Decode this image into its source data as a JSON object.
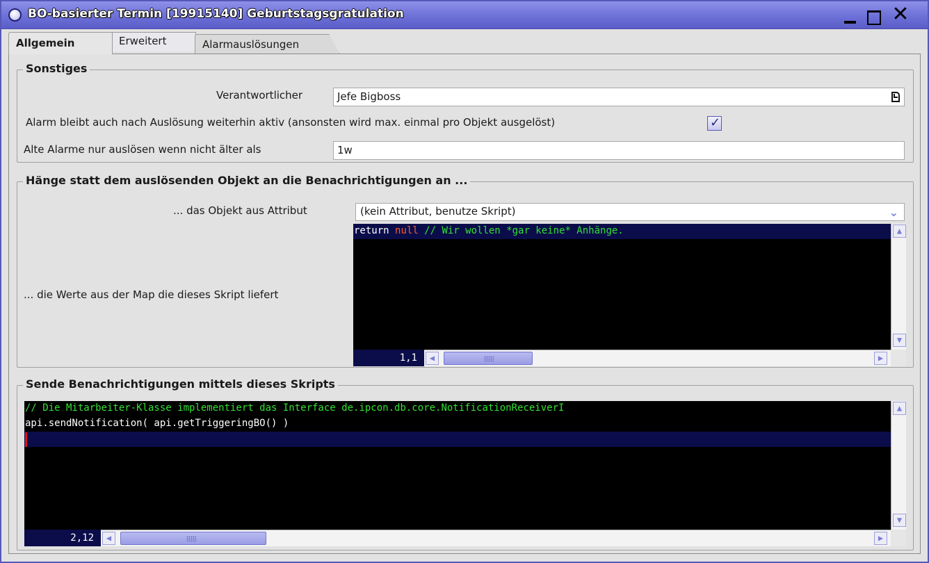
{
  "window": {
    "title": "BO-basierter Termin [19915140] Geburtstagsgratulation",
    "close_glyph": "✕"
  },
  "tabs": [
    {
      "label": "Allgemein",
      "active": true
    },
    {
      "label": "Erweitert",
      "active": false
    },
    {
      "label": "Alarmauslösungen",
      "active": false
    }
  ],
  "sonstiges": {
    "title": "Sonstiges",
    "verantwortlicher_label": "Verantwortlicher",
    "verantwortlicher_value": "Jefe Bigboss",
    "alarm_aktiv_label": "Alarm bleibt auch nach Auslösung weiterhin aktiv (ansonsten wird max. einmal pro Objekt ausgelöst)",
    "alarm_aktiv_checked": true,
    "check_glyph": "✓",
    "alte_alarme_label": "Alte Alarme nur auslösen wenn nicht älter als",
    "alte_alarme_value": "1w"
  },
  "anhaenge": {
    "title": "Hänge statt dem auslösenden Objekt an die Benachrichtigungen an ...",
    "objekt_label": "... das Objekt aus Attribut",
    "objekt_value": "(kein Attribut, benutze Skript)",
    "chevron_glyph": "⌄",
    "map_label": "... die Werte aus der Map die dieses Skript liefert",
    "script": {
      "keyword_return": "return ",
      "keyword_null": "null",
      "comment": " // Wir wollen *gar keine* Anhänge."
    },
    "cursor_pos": "1,1"
  },
  "senden": {
    "title": "Sende Benachrichtigungen mittels dieses Skripts",
    "script_lines": [
      "// Die Mitarbeiter-Klasse implementiert das Interface de.ipcon.db.core.NotificationReceiverI",
      "api.sendNotification( api.getTriggeringBO() )"
    ],
    "cursor_pos": "2,12"
  },
  "scroll": {
    "up": "▲",
    "down": "▼",
    "left": "◀",
    "right": "▶"
  },
  "colors": {
    "titlebar": "#6d70d6",
    "editor_bg": "#000000",
    "editor_highlight": "#0b0d4a",
    "comment": "#33e033",
    "keyword_null": "#ff5a2a"
  }
}
